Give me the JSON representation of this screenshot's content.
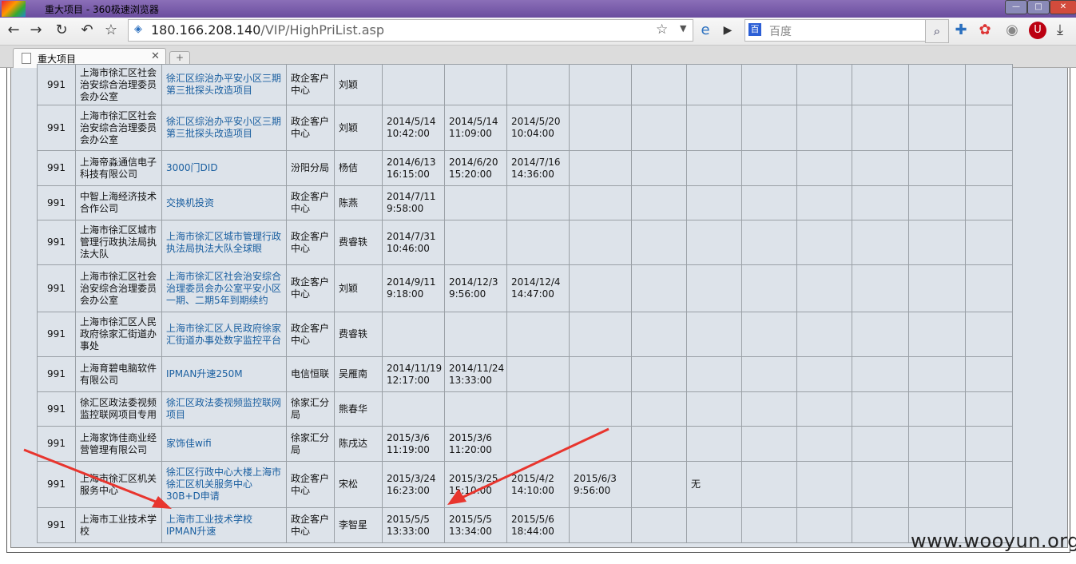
{
  "window": {
    "title": "重大项目 - 360极速浏览器"
  },
  "toolbar": {
    "url_host": "180.166.208.140",
    "url_path": "/VIP/HighPriList.asp",
    "search_placeholder": "百度"
  },
  "tab": {
    "title": "重大项目"
  },
  "table": {
    "rows": [
      {
        "id": "991",
        "org": "上海市徐汇区社会治安综合治理委员会办公室",
        "project": "徐汇区综治办平安小区三期第三批探头改造项目",
        "dept": "政企客户中心",
        "person": "刘颖",
        "d1": "",
        "d2": "",
        "d3": "",
        "d4": "",
        "d6": ""
      },
      {
        "id": "991",
        "org": "上海市徐汇区社会治安综合治理委员会办公室",
        "project": "徐汇区综治办平安小区三期第三批探头改造项目",
        "dept": "政企客户中心",
        "person": "刘颖",
        "d1": "2014/5/14 10:42:00",
        "d2": "2014/5/14 11:09:00",
        "d3": "2014/5/20 10:04:00",
        "d4": "",
        "d6": ""
      },
      {
        "id": "991",
        "org": "上海帝淼通信电子科技有限公司",
        "project": "3000门DID",
        "dept": "汾阳分局",
        "person": "杨佶",
        "d1": "2014/6/13 16:15:00",
        "d2": "2014/6/20 15:20:00",
        "d3": "2014/7/16 14:36:00",
        "d4": "",
        "d6": ""
      },
      {
        "id": "991",
        "org": "中智上海经济技术合作公司",
        "project": "交换机投资",
        "dept": "政企客户中心",
        "person": "陈燕",
        "d1": "2014/7/11 9:58:00",
        "d2": "",
        "d3": "",
        "d4": "",
        "d6": ""
      },
      {
        "id": "991",
        "org": "上海市徐汇区城市管理行政执法局执法大队",
        "project": "上海市徐汇区城市管理行政执法局执法大队全球眼",
        "dept": "政企客户中心",
        "person": "费睿轶",
        "d1": "2014/7/31 10:46:00",
        "d2": "",
        "d3": "",
        "d4": "",
        "d6": ""
      },
      {
        "id": "991",
        "org": "上海市徐汇区社会治安综合治理委员会办公室",
        "project": "上海市徐汇区社会治安综合治理委员会办公室平安小区一期、二期5年到期续约",
        "dept": "政企客户中心",
        "person": "刘颖",
        "d1": "2014/9/11 9:18:00",
        "d2": "2014/12/3 9:56:00",
        "d3": "2014/12/4 14:47:00",
        "d4": "",
        "d6": ""
      },
      {
        "id": "991",
        "org": "上海市徐汇区人民政府徐家汇街道办事处",
        "project": "上海市徐汇区人民政府徐家汇街道办事处数字监控平台",
        "dept": "政企客户中心",
        "person": "费睿轶",
        "d1": "",
        "d2": "",
        "d3": "",
        "d4": "",
        "d6": ""
      },
      {
        "id": "991",
        "org": "上海育碧电脑软件有限公司",
        "project": "IPMAN升速250M",
        "dept": "电信恒联",
        "person": "吴雁南",
        "d1": "2014/11/19 12:17:00",
        "d2": "2014/11/24 13:33:00",
        "d3": "",
        "d4": "",
        "d6": ""
      },
      {
        "id": "991",
        "org": "徐汇区政法委视频监控联网项目专用",
        "project": "徐汇区政法委视频监控联网项目",
        "dept": "徐家汇分局",
        "person": "熊春华",
        "d1": "",
        "d2": "",
        "d3": "",
        "d4": "",
        "d6": ""
      },
      {
        "id": "991",
        "org": "上海家饰佳商业经营管理有限公司",
        "project": "家饰佳wifi",
        "dept": "徐家汇分局",
        "person": "陈戌达",
        "d1": "2015/3/6 11:19:00",
        "d2": "2015/3/6 11:20:00",
        "d3": "",
        "d4": "",
        "d6": ""
      },
      {
        "id": "991",
        "org": "上海市徐汇区机关服务中心",
        "project": "徐汇区行政中心大楼上海市徐汇区机关服务中心30B+D申请",
        "dept": "政企客户中心",
        "person": "宋松",
        "d1": "2015/3/24 16:23:00",
        "d2": "2015/3/25 15:10:00",
        "d3": "2015/4/2 14:10:00",
        "d4": "2015/6/3 9:56:00",
        "d6": "无"
      },
      {
        "id": "991",
        "org": "上海市工业技术学校",
        "project": "上海市工业技术学校IPMAN升速",
        "dept": "政企客户中心",
        "person": "李智星",
        "d1": "2015/5/5 13:33:00",
        "d2": "2015/5/5 13:34:00",
        "d3": "2015/5/6 18:44:00",
        "d4": "",
        "d6": ""
      }
    ]
  },
  "watermark": "www.wooyun.org",
  "colors": {
    "annotation_arrow": "#e8352e",
    "table_bg": "#dde3ea",
    "link_text": "#1a5fa0",
    "titlebar": "#7a5cab"
  }
}
